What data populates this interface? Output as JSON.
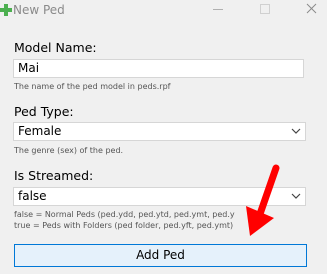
{
  "window": {
    "title": "New Ped",
    "icons": {
      "app": "plus-icon",
      "minimize": "minimize-icon",
      "maximize": "maximize-icon",
      "close": "close-icon"
    }
  },
  "form": {
    "model_name": {
      "label": "Model Name:",
      "value": "Mai",
      "hint": "The name of the ped model in peds.rpf"
    },
    "ped_type": {
      "label": "Ped Type:",
      "selected": "Female",
      "hint": "The genre (sex) of the ped."
    },
    "is_streamed": {
      "label": "Is Streamed:",
      "selected": "false",
      "hint_false": "false = Normal Peds (ped.ydd, ped.ytd, ped.ymt, ped.y",
      "hint_true": "true = Peds with Folders (ped folder, ped.yft, ped.ymt)"
    },
    "add_button_label": "Add Ped"
  },
  "colors": {
    "accent_border": "#0078d7",
    "button_bg": "#e5f1fb",
    "annotation_arrow": "#ff0000",
    "app_icon": "#4caf50"
  }
}
